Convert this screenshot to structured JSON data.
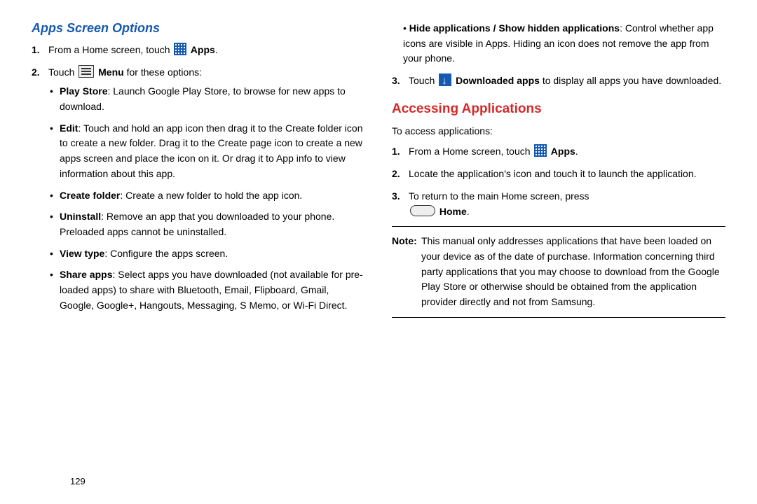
{
  "left": {
    "heading": "Apps Screen Options",
    "step1_a": "From a Home screen, touch ",
    "step1_b": " Apps",
    "step1_c": ".",
    "step2_a": "Touch ",
    "step2_b": " Menu",
    "step2_c": " for these options:",
    "bullets": {
      "playstore_label": "Play Store",
      "playstore_text": ": Launch Google Play Store, to browse for new apps to download.",
      "edit_label": "Edit",
      "edit_text": ": Touch and hold an app icon then drag it to the Create folder icon to create a new folder. Drag it to the Create page icon to create a new apps screen and place the icon on it. Or drag it to App info to view information about this app.",
      "createfolder_label": "Create folder",
      "createfolder_text": ": Create a new folder to hold the app icon.",
      "uninstall_label": "Uninstall",
      "uninstall_text": ": Remove an app that you downloaded to your phone. Preloaded apps cannot be uninstalled.",
      "viewtype_label": "View type",
      "viewtype_text": ": Configure the apps screen.",
      "shareapps_label": "Share apps",
      "shareapps_text": ": Select apps you have downloaded (not available for pre-loaded apps) to share with Bluetooth, Email, Flipboard, Gmail, Google, Google+, Hangouts, Messaging, S Memo, or Wi-Fi Direct."
    }
  },
  "right": {
    "hide_label": "Hide applications / Show hidden applications",
    "hide_text": ": Control whether app icons are visible in Apps. Hiding an icon does not remove the app from your phone.",
    "step3_a": "Touch ",
    "step3_b": " Downloaded apps",
    "step3_c": " to display all apps you have downloaded.",
    "heading2": "Accessing Applications",
    "intro": "To access applications:",
    "acc_step1_a": "From a Home screen, touch ",
    "acc_step1_b": " Apps",
    "acc_step1_c": ".",
    "acc_step2": "Locate the application's icon and touch it to launch the application.",
    "acc_step3_a": "To return to the main Home screen, press ",
    "acc_step3_b": " Home",
    "acc_step3_c": ".",
    "note_label": "Note:",
    "note_text": "This manual only addresses applications that have been loaded on your device as of the date of purchase. Information concerning third party applications that you may choose to download from the Google Play Store or otherwise should be obtained from the application provider directly and not from Samsung."
  },
  "page_number": "129"
}
